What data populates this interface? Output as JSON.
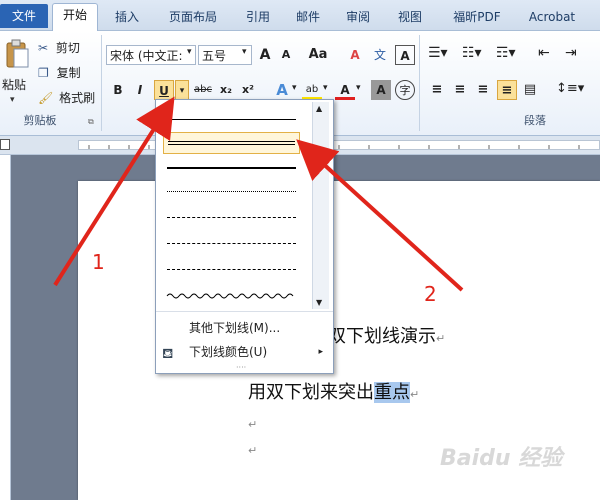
{
  "tabs": [
    "文件",
    "开始",
    "插入",
    "页面布局",
    "引用",
    "邮件",
    "审阅",
    "视图",
    "福昕PDF",
    "Acrobat"
  ],
  "clipboard": {
    "paste_label": "粘贴",
    "cut_label": "剪切",
    "copy_label": "复制",
    "format_painter_label": "格式刷",
    "group_label": "剪贴板"
  },
  "font": {
    "font_name": "宋体 (中文正:",
    "font_size": "五号",
    "grow": "A",
    "shrink": "A",
    "change_case": "Aa",
    "clear": "A",
    "phonetic": "文",
    "bold": "B",
    "italic": "I",
    "underline": "U",
    "strike": "abc",
    "subscript": "x₂",
    "superscript": "x²",
    "effects": "A",
    "highlight": "ab",
    "color": "A",
    "char_shading": "A",
    "enclose": "字"
  },
  "paragraph": {
    "group_label": "段落"
  },
  "underline_menu": {
    "more_underlines": "其他下划线(M)...",
    "underline_color": "下划线颜色(U)"
  },
  "document": {
    "line1": "双下划线演示",
    "line2_prefix": "用双下划来突出",
    "line2_highlight": "重点",
    "return_mark": "↵"
  },
  "annotations": {
    "label1": "1",
    "label2": "2"
  },
  "watermark": "Baidu 经验",
  "colors": {
    "accent": "#2a64b4",
    "arrow": "#e0251b",
    "selection": "#a8c8ee",
    "button_highlight": "#fbe19a"
  }
}
